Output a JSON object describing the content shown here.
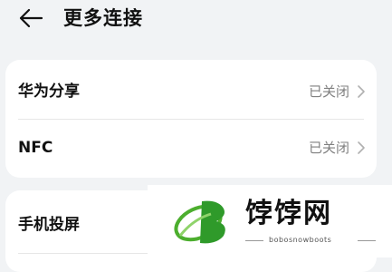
{
  "header": {
    "back_icon": "back-arrow-icon",
    "title": "更多连接"
  },
  "card1": {
    "items": [
      {
        "label": "华为分享",
        "value": "已关闭",
        "icon": "chevron-right-icon"
      },
      {
        "label": "NFC",
        "value": "已关闭",
        "icon": "chevron-right-icon"
      }
    ]
  },
  "card2": {
    "items": [
      {
        "label": "手机投屏"
      }
    ]
  },
  "watermark": {
    "brand": "饽饽网",
    "sub": "bobosnowboots"
  },
  "colors": {
    "background": "#f1f3f5",
    "card": "#ffffff",
    "secondary_text": "#808080",
    "logo_green": "#4cae2e"
  }
}
